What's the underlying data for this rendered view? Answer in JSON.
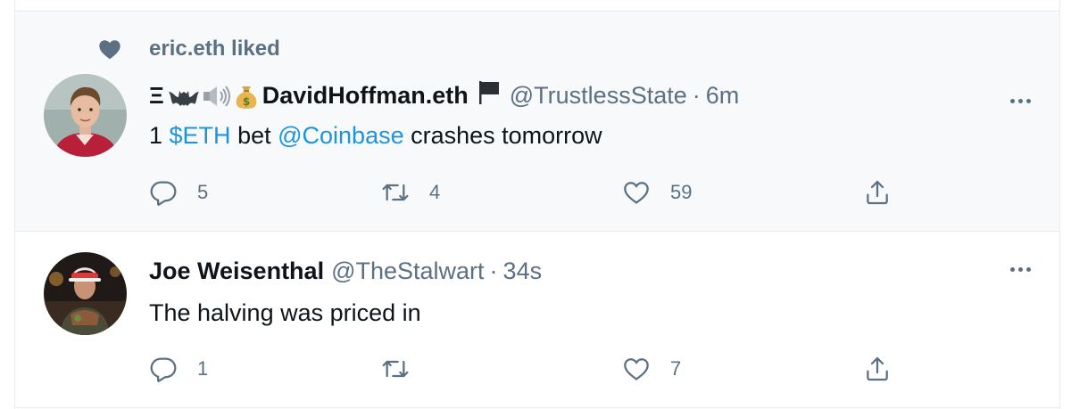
{
  "tweets": [
    {
      "social_context": "eric.eth liked",
      "display_prefix": "Ξ",
      "display_name": "DavidHoffman.eth",
      "handle": "@TrustlessState",
      "separator": "·",
      "time": "6m",
      "body": {
        "part1": "1 ",
        "cashtag": "$ETH",
        "part2": " bet ",
        "mention": "@Coinbase",
        "part3": " crashes tomorrow"
      },
      "counts": {
        "reply": "5",
        "retweet": "4",
        "like": "59"
      },
      "icons": [
        "heart-icon",
        "bat-emoji-icon",
        "speaker-emoji-icon",
        "money-bag-emoji-icon",
        "black-flag-icon",
        "more-icon",
        "reply-icon",
        "retweet-icon",
        "like-icon",
        "share-icon"
      ]
    },
    {
      "display_name": "Joe Weisenthal",
      "handle": "@TheStalwart",
      "separator": "·",
      "time": "34s",
      "body": "The halving was priced in",
      "counts": {
        "reply": "1",
        "retweet": "",
        "like": "7"
      },
      "icons": [
        "more-icon",
        "reply-icon",
        "retweet-icon",
        "like-icon",
        "share-icon"
      ]
    }
  ],
  "colors": {
    "secondary_text": "#5b7083",
    "link": "#1b95e0",
    "highlight_bg": "#f7f9fa",
    "border": "#e6ecf0"
  }
}
